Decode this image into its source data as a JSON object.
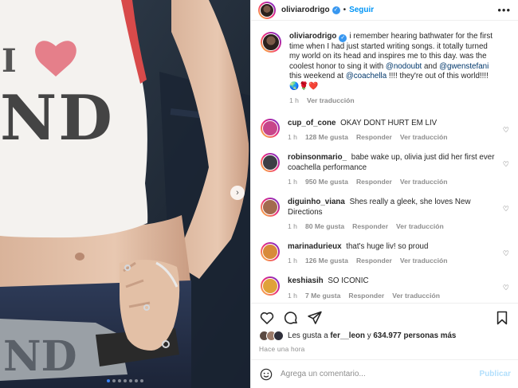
{
  "colors": {
    "accent": "#0095f6",
    "muted": "#8e8e8e",
    "mention": "#00376b",
    "verified": "#3897f0",
    "carousel_active": "#3b82f6"
  },
  "photo": {
    "shirt_letters_left": "I",
    "shirt_letters_main": "ND",
    "carousel_dots": 7,
    "active_dot": 0,
    "next_icon": "chevron-right-icon"
  },
  "header": {
    "username": "oliviarodrigo",
    "separator": "•",
    "follow_label": "Seguir",
    "more_icon": "ellipsis-icon",
    "more_label": "•••"
  },
  "caption": {
    "username": "oliviarodrigo",
    "text_1": "i remember hearing bathwater for the first time when I had just started writing songs. it totally turned my world on its head and inspires me to this day. was the coolest honor to sing it with ",
    "mention_1": "@nodoubt",
    "text_2": " and ",
    "mention_2": "@gwenstefani",
    "text_3": " this weekend at ",
    "mention_3": "@coachella",
    "text_4": " !!!! they're out of this world!!!! 🌏🌹❤️",
    "time": "1 h",
    "translate": "Ver traducción"
  },
  "comments": [
    {
      "username": "cup_of_cone",
      "text": "OKAY DONT HURT EM LIV",
      "time": "1 h",
      "likes": "128 Me gusta",
      "reply": "Responder",
      "translate": "Ver traducción",
      "avatar_color": "#c7468a"
    },
    {
      "username": "robinsonmario_",
      "text": "babe wake up, olivia just did her first ever coachella performance",
      "time": "1 h",
      "likes": "950 Me gusta",
      "reply": "Responder",
      "translate": "Ver traducción",
      "avatar_color": "#3d3f45"
    },
    {
      "username": "diguinho_viana",
      "text": "Shes really a gleek, she loves New Directions",
      "time": "1 h",
      "likes": "80 Me gusta",
      "reply": "Responder",
      "translate": "Ver traducción",
      "avatar_color": "#a36b4f"
    },
    {
      "username": "marinadurieux",
      "text": "that's huge liv! so proud",
      "time": "1 h",
      "likes": "126 Me gusta",
      "reply": "Responder",
      "translate": "Ver traducción",
      "avatar_color": "#d88a3a"
    },
    {
      "username": "keshiasih",
      "text": "SO ICONIC",
      "time": "1 h",
      "likes": "7 Me gusta",
      "reply": "Responder",
      "translate": "Ver traducción",
      "avatar_color": "#e0a23a"
    }
  ],
  "actions": {
    "like_icon": "heart-icon",
    "comment_icon": "comment-icon",
    "share_icon": "share-icon",
    "save_icon": "bookmark-icon",
    "likes_prefix": "Les gusta a ",
    "likes_user": "fer__leon",
    "likes_mid": " y ",
    "likes_count": "634.977 personas más",
    "time_ago": "Hace una hora"
  },
  "compose": {
    "emoji_icon": "smiley-icon",
    "placeholder": "Agrega un comentario...",
    "publish_label": "Publicar"
  }
}
